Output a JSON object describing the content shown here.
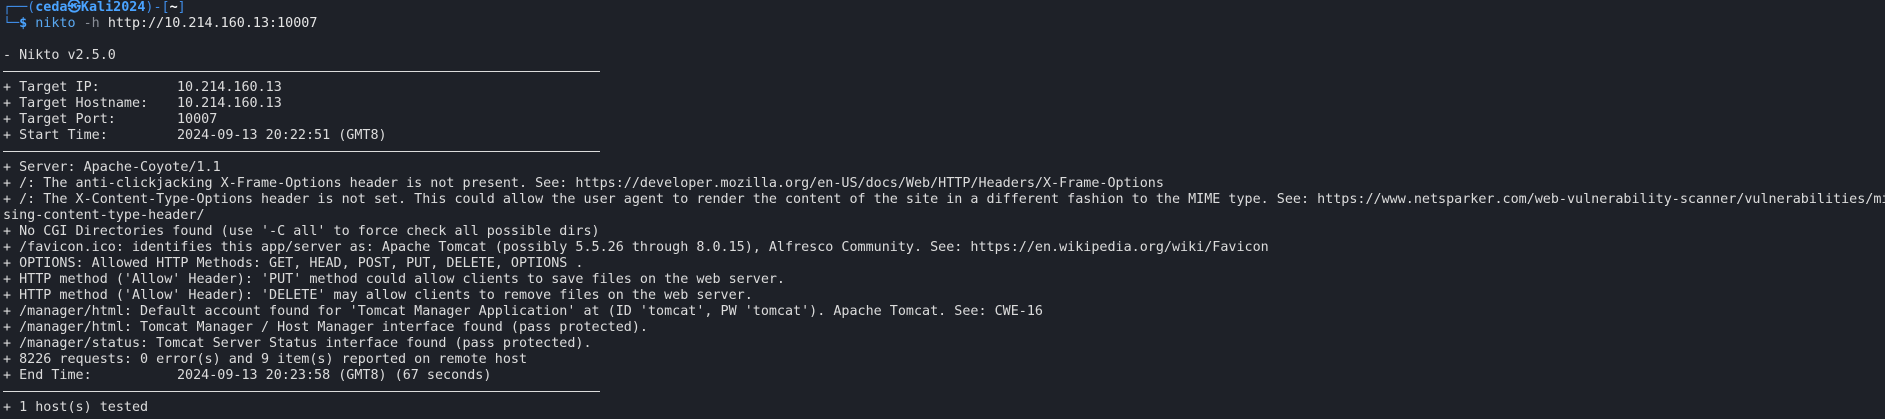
{
  "prompt": {
    "corner_top": "┌──(",
    "user": "ceda",
    "at_symbol": "㉿",
    "host": "Kali2024",
    "mid": ")-[",
    "path": "~",
    "close": "]",
    "corner_bottom": "└─",
    "dollar": "$ ",
    "command": "nikto",
    "flag": " -h ",
    "target_url": "http://10.214.160.13:10007"
  },
  "header": {
    "version_line": "- Nikto v2.5.0"
  },
  "target_info": [
    {
      "key": "+ Target IP:",
      "value": "10.214.160.13"
    },
    {
      "key": "+ Target Hostname:",
      "value": "10.214.160.13"
    },
    {
      "key": "+ Target Port:",
      "value": "10007"
    },
    {
      "key": "+ Start Time:",
      "value": "2024-09-13 20:22:51 (GMT8)"
    }
  ],
  "findings": [
    "+ Server: Apache-Coyote/1.1",
    "+ /: The anti-clickjacking X-Frame-Options header is not present. See: https://developer.mozilla.org/en-US/docs/Web/HTTP/Headers/X-Frame-Options",
    "+ /: The X-Content-Type-Options header is not set. This could allow the user agent to render the content of the site in a different fashion to the MIME type. See: https://www.netsparker.com/web-vulnerability-scanner/vulnerabilities/mis",
    "sing-content-type-header/",
    "+ No CGI Directories found (use '-C all' to force check all possible dirs)",
    "+ /favicon.ico: identifies this app/server as: Apache Tomcat (possibly 5.5.26 through 8.0.15), Alfresco Community. See: https://en.wikipedia.org/wiki/Favicon",
    "+ OPTIONS: Allowed HTTP Methods: GET, HEAD, POST, PUT, DELETE, OPTIONS .",
    "+ HTTP method ('Allow' Header): 'PUT' method could allow clients to save files on the web server.",
    "+ HTTP method ('Allow' Header): 'DELETE' may allow clients to remove files on the web server.",
    "+ /manager/html: Default account found for 'Tomcat Manager Application' at (ID 'tomcat', PW 'tomcat'). Apache Tomcat. See: CWE-16",
    "+ /manager/html: Tomcat Manager / Host Manager interface found (pass protected).",
    "+ /manager/status: Tomcat Server Status interface found (pass protected).",
    "+ 8226 requests: 0 error(s) and 9 item(s) reported on remote host"
  ],
  "end_info": {
    "key": "+ End Time:",
    "value": "2024-09-13 20:23:58 (GMT8) (67 seconds)"
  },
  "footer": {
    "hosts_tested": "+ 1 host(s) tested"
  },
  "colors": {
    "background": "#1e2128",
    "text": "#dcdcdc",
    "prompt_blue": "#3f8ce6",
    "prompt_user": "#4aa3ff"
  }
}
